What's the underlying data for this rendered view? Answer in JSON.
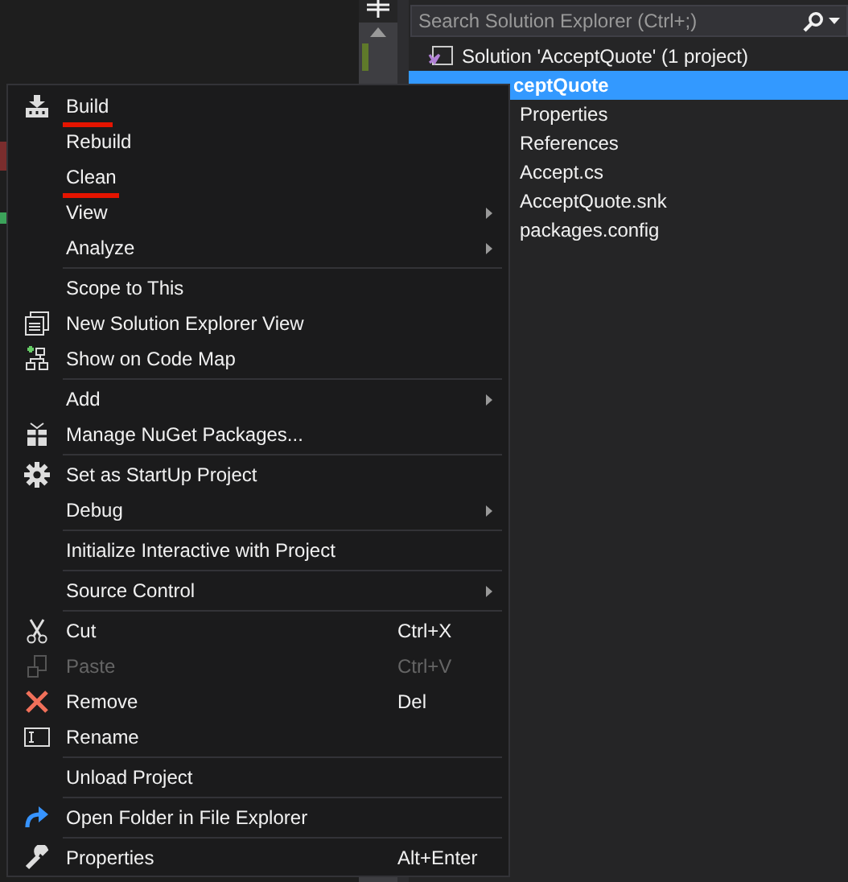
{
  "solution_explorer": {
    "search": {
      "placeholder": "Search Solution Explorer (Ctrl+;)"
    },
    "tree": [
      {
        "label": "Solution 'AcceptQuote' (1 project)",
        "selected": false,
        "children": [
          {
            "label": "ceptQuote",
            "selected": true,
            "children": [
              {
                "label": "Properties",
                "selected": false
              },
              {
                "label": "References",
                "selected": false
              },
              {
                "label": "Accept.cs",
                "selected": false
              },
              {
                "label": "AcceptQuote.snk",
                "selected": false
              },
              {
                "label": "packages.config",
                "selected": false
              }
            ]
          }
        ]
      }
    ]
  },
  "context_menu": {
    "sections": [
      [
        {
          "label": "Build",
          "submenu": false,
          "disabled": false,
          "underlined": true
        },
        {
          "label": "Rebuild",
          "submenu": false,
          "disabled": false,
          "underlined": false
        },
        {
          "label": "Clean",
          "submenu": false,
          "disabled": false,
          "underlined": true
        },
        {
          "label": "View",
          "submenu": true,
          "disabled": false,
          "underlined": false
        },
        {
          "label": "Analyze",
          "submenu": true,
          "disabled": false,
          "underlined": false
        }
      ],
      [
        {
          "label": "Scope to This",
          "submenu": false,
          "disabled": false,
          "underlined": false
        },
        {
          "label": "New Solution Explorer View",
          "submenu": false,
          "disabled": false,
          "underlined": false
        },
        {
          "label": "Show on Code Map",
          "submenu": false,
          "disabled": false,
          "underlined": false
        }
      ],
      [
        {
          "label": "Add",
          "submenu": true,
          "disabled": false,
          "underlined": false
        },
        {
          "label": "Manage NuGet Packages...",
          "submenu": false,
          "disabled": false,
          "underlined": false
        }
      ],
      [
        {
          "label": "Set as StartUp Project",
          "submenu": false,
          "disabled": false,
          "underlined": false
        },
        {
          "label": "Debug",
          "submenu": true,
          "disabled": false,
          "underlined": false
        }
      ],
      [
        {
          "label": "Initialize Interactive with Project",
          "submenu": false,
          "disabled": false,
          "underlined": false
        }
      ],
      [
        {
          "label": "Source Control",
          "submenu": true,
          "disabled": false,
          "underlined": false
        }
      ],
      [
        {
          "label": "Cut",
          "shortcut": "Ctrl+X",
          "submenu": false,
          "disabled": false,
          "underlined": false
        },
        {
          "label": "Paste",
          "shortcut": "Ctrl+V",
          "submenu": false,
          "disabled": true,
          "underlined": false
        },
        {
          "label": "Remove",
          "shortcut": "Del",
          "submenu": false,
          "disabled": false,
          "underlined": false
        },
        {
          "label": "Rename",
          "submenu": false,
          "disabled": false,
          "underlined": false
        }
      ],
      [
        {
          "label": "Unload Project",
          "submenu": false,
          "disabled": false,
          "underlined": false
        }
      ],
      [
        {
          "label": "Open Folder in File Explorer",
          "submenu": false,
          "disabled": false,
          "underlined": false
        }
      ],
      [
        {
          "label": "Properties",
          "shortcut": "Alt+Enter",
          "submenu": false,
          "disabled": false,
          "underlined": false
        }
      ]
    ]
  }
}
